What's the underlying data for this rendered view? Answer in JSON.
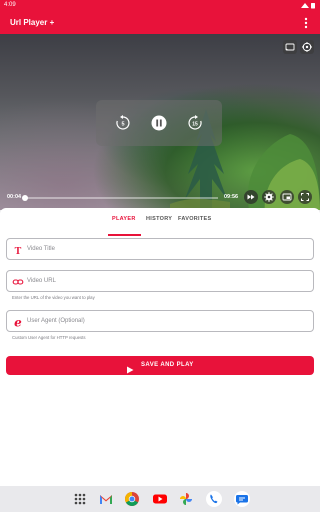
{
  "status_bar": {
    "time": "4:09"
  },
  "app_bar": {
    "title": "Url Player +",
    "more_icon": "more-vert-icon"
  },
  "player": {
    "current_time": "00:04",
    "duration": "09:56",
    "progress": 0.007,
    "overlay_icons": [
      "cast-icon",
      "network-icon"
    ],
    "center_controls": [
      "replay-5-icon",
      "pause-icon",
      "forward-15-icon"
    ],
    "bottom_controls": [
      "speed-icon",
      "settings-icon",
      "picture-in-picture-icon",
      "fullscreen-icon"
    ]
  },
  "tabs": [
    {
      "label": "PLAYER",
      "active": true
    },
    {
      "label": "HISTORY",
      "active": false
    },
    {
      "label": "FAVORITES",
      "active": false
    }
  ],
  "form": {
    "title_field": {
      "placeholder": "Video Title",
      "icon": "title-icon"
    },
    "url_field": {
      "placeholder": "Video URL",
      "icon": "link-icon",
      "helper": "Enter the URL of the video you want to play"
    },
    "agent_field": {
      "placeholder": "User Agent (Optional)",
      "icon": "edge-browser-icon",
      "helper": "Custom User Agent for HTTP requests"
    },
    "submit_label": "SAVE AND PLAY"
  },
  "colors": {
    "accent": "#e8123a"
  },
  "dock": [
    "app-drawer-icon",
    "gmail-icon",
    "chrome-icon",
    "youtube-icon",
    "photos-icon",
    "phone-icon",
    "messages-icon"
  ]
}
